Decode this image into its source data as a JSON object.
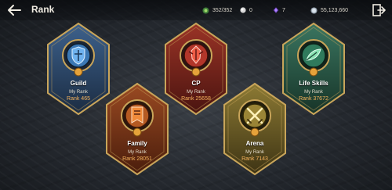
{
  "header": {
    "title": "Rank",
    "resources": [
      {
        "icon": "green-gem-icon",
        "value": "352/352"
      },
      {
        "icon": "white-orb-icon",
        "value": "0"
      },
      {
        "icon": "purple-crystal-icon",
        "value": "7"
      },
      {
        "icon": "silver-coin-icon",
        "value": "55,123,660"
      }
    ]
  },
  "badges": [
    {
      "key": "guild",
      "name": "Guild",
      "sub": "My Rank",
      "rank": "Rank 465",
      "color": "#2f4f74",
      "icon": "shield-icon"
    },
    {
      "key": "cp",
      "name": "CP",
      "sub": "My Rank",
      "rank": "Rank 25658",
      "color": "#7a2620",
      "icon": "combat-power-icon"
    },
    {
      "key": "life-skills",
      "name": "Life Skills",
      "sub": "My Rank",
      "rank": "Rank 37672",
      "color": "#2d5a48",
      "icon": "life-skills-icon"
    },
    {
      "key": "family",
      "name": "Family",
      "sub": "My Rank",
      "rank": "Rank 28051",
      "color": "#7a3a1c",
      "icon": "family-banner-icon"
    },
    {
      "key": "arena",
      "name": "Arena",
      "sub": "My Rank",
      "rank": "Rank 7143",
      "color": "#70602a",
      "icon": "crossed-swords-icon"
    }
  ],
  "colors": {
    "gold": "#c9a55a",
    "rank_text": "#f6b35c"
  }
}
